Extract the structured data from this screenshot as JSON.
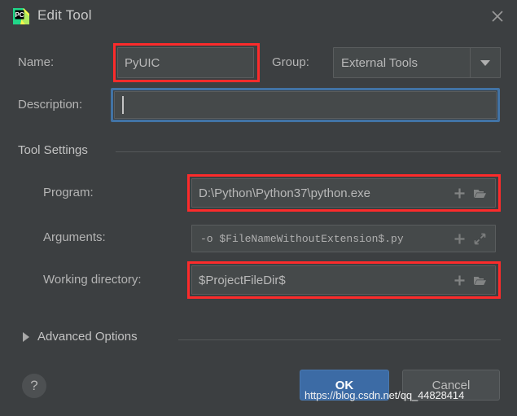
{
  "window": {
    "title": "Edit Tool",
    "app_icon": "pycharm-logo-icon",
    "close_icon": "close-icon"
  },
  "form": {
    "name": {
      "label": "Name:",
      "value": "PyUIC",
      "highlighted": true
    },
    "group": {
      "label": "Group:",
      "value": "External Tools",
      "options": [
        "External Tools"
      ]
    },
    "description": {
      "label": "Description:",
      "value": "",
      "placeholder": "",
      "focused": true
    }
  },
  "tool_settings": {
    "section_label": "Tool Settings",
    "program": {
      "label": "Program:",
      "value": "D:\\Python\\Python37\\python.exe",
      "add_icon": "plus-icon",
      "browse_icon": "folder-icon",
      "highlighted": true
    },
    "arguments": {
      "label": "Arguments:",
      "value": "-o $FileNameWithoutExtension$.py",
      "add_icon": "plus-icon",
      "expand_icon": "expand-arrows-icon",
      "highlighted": false
    },
    "working_directory": {
      "label": "Working directory:",
      "value": "$ProjectFileDir$",
      "add_icon": "plus-icon",
      "browse_icon": "folder-icon",
      "highlighted": true
    }
  },
  "advanced": {
    "label": "Advanced Options",
    "expanded": false,
    "chevron_icon": "chevron-right-icon"
  },
  "footer": {
    "help_label": "?",
    "ok_label": "OK",
    "cancel_label": "Cancel"
  },
  "watermark": {
    "text": "https://blog.csdn.net/qq_44828414"
  },
  "colors": {
    "dialog_background": "#3c3f41",
    "field_background": "#45494a",
    "text_primary": "#b9b9b9",
    "accent_ok": "#3c6ba5",
    "annotation_red": "#fc2b2b",
    "focus_blue": "#4273a5"
  }
}
